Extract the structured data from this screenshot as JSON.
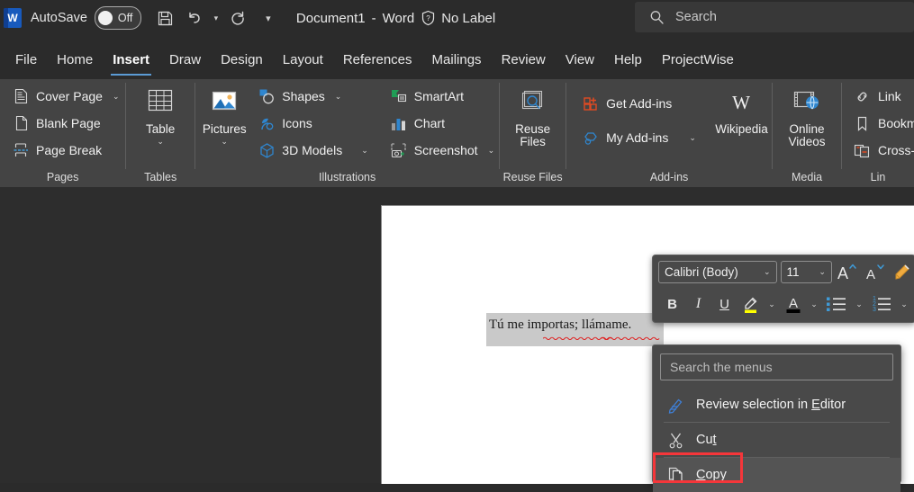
{
  "titlebar": {
    "app_icon": "word-logo",
    "autosave_label": "AutoSave",
    "autosave_state": "Off",
    "save_icon": "save-icon",
    "undo_icon": "undo-icon",
    "redo_icon": "redo-icon",
    "customize_icon": "customize-quick-access-toolbar-icon",
    "document_name": "Document1",
    "separator": "-",
    "app_name": "Word",
    "sensitivity_icon": "shield-question-icon",
    "sensitivity_label": "No Label",
    "search_icon": "search-icon",
    "search_placeholder": "Search"
  },
  "tabs": [
    {
      "label": "File",
      "active": false
    },
    {
      "label": "Home",
      "active": false
    },
    {
      "label": "Insert",
      "active": true
    },
    {
      "label": "Draw",
      "active": false
    },
    {
      "label": "Design",
      "active": false
    },
    {
      "label": "Layout",
      "active": false
    },
    {
      "label": "References",
      "active": false
    },
    {
      "label": "Mailings",
      "active": false
    },
    {
      "label": "Review",
      "active": false
    },
    {
      "label": "View",
      "active": false
    },
    {
      "label": "Help",
      "active": false
    },
    {
      "label": "ProjectWise",
      "active": false
    }
  ],
  "ribbon": {
    "groups": [
      {
        "name": "Pages",
        "items": [
          {
            "label": "Cover Page",
            "icon": "cover-page-icon",
            "caret": "⌄"
          },
          {
            "label": "Blank Page",
            "icon": "blank-page-icon",
            "caret": ""
          },
          {
            "label": "Page Break",
            "icon": "page-break-icon",
            "caret": ""
          }
        ]
      },
      {
        "name": "Tables",
        "items": [
          {
            "label": "Table",
            "icon": "table-icon",
            "caret": "⌄"
          }
        ]
      },
      {
        "name": "Illustrations",
        "items": [
          {
            "label": "Pictures",
            "icon": "pictures-icon",
            "caret": "⌄"
          },
          {
            "label": "Shapes",
            "icon": "shapes-icon",
            "caret": "⌄"
          },
          {
            "label": "Icons",
            "icon": "icons-icon",
            "caret": ""
          },
          {
            "label": "3D Models",
            "icon": "3d-models-icon",
            "caret": "⌄"
          },
          {
            "label": "SmartArt",
            "icon": "smartart-icon",
            "caret": ""
          },
          {
            "label": "Chart",
            "icon": "chart-icon",
            "caret": ""
          },
          {
            "label": "Screenshot",
            "icon": "screenshot-icon",
            "caret": "⌄"
          }
        ]
      },
      {
        "name": "Reuse Files",
        "items": [
          {
            "label": "Reuse Files",
            "icon": "reuse-files-icon",
            "caret": ""
          }
        ]
      },
      {
        "name": "Add-ins",
        "items": [
          {
            "label": "Get Add-ins",
            "icon": "get-add-ins-icon",
            "caret": ""
          },
          {
            "label": "My Add-ins",
            "icon": "my-add-ins-icon",
            "caret": "⌄"
          },
          {
            "label": "Wikipedia",
            "icon": "wikipedia-icon",
            "caret": ""
          }
        ]
      },
      {
        "name": "Media",
        "items": [
          {
            "label": "Online Videos",
            "icon": "online-videos-icon",
            "caret": ""
          }
        ]
      },
      {
        "name": "Lin",
        "items": [
          {
            "label": "Link",
            "icon": "link-icon",
            "caret": ""
          },
          {
            "label": "Bookm",
            "icon": "bookmark-icon",
            "caret": ""
          },
          {
            "label": "Cross-",
            "icon": "cross-reference-icon",
            "caret": ""
          }
        ]
      }
    ]
  },
  "document": {
    "selected_text": "Tú me importas; llámame."
  },
  "mini_toolbar": {
    "font_name": "Calibri (Body)",
    "font_size": "11",
    "grow_font_icon": "grow-font-icon",
    "shrink_font_icon": "shrink-font-icon",
    "format_painter_icon": "format-painter-icon",
    "bold_label": "B",
    "italic_label": "I",
    "underline_label": "U",
    "highlight_icon": "text-highlight-color-icon",
    "font_color_icon": "font-color-icon",
    "bullets_icon": "bullets-icon",
    "numbering_icon": "numbering-icon",
    "highlight_color": "#ffff00",
    "font_color": "#000000",
    "caret": "⌄"
  },
  "context_menu": {
    "search_placeholder": "Search the menus",
    "items": [
      {
        "label": "Review selection in Editor",
        "icon": "editor-icon",
        "accel": "E",
        "highlighted": false
      },
      {
        "label": "Cut",
        "icon": "cut-icon",
        "accel": "t",
        "highlighted": false
      },
      {
        "label": "Copy",
        "icon": "copy-icon",
        "accel": "C",
        "highlighted": true
      }
    ],
    "highlight_color": "#f5363a"
  }
}
